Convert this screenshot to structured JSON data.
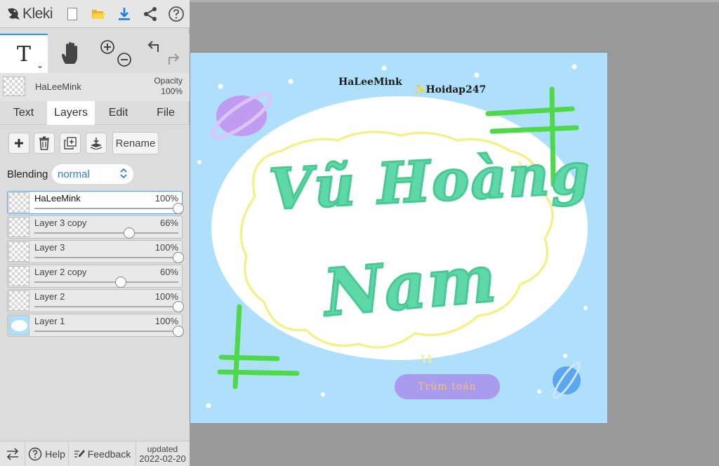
{
  "app": {
    "name": "Kleki"
  },
  "toolbar": {
    "icons": [
      "new-image-icon",
      "open-folder-icon",
      "download-icon",
      "share-icon",
      "help-icon"
    ]
  },
  "tools": {
    "text_tool_glyph": "T",
    "caret": "⌄"
  },
  "active_layer": {
    "name": "HaLeeMink",
    "opacity_label": "Opacity",
    "opacity_value": "100%"
  },
  "tabs": [
    {
      "label": "Text",
      "active": false
    },
    {
      "label": "Layers",
      "active": true
    },
    {
      "label": "Edit",
      "active": false
    },
    {
      "label": "File",
      "active": false
    }
  ],
  "layers_panel": {
    "rename_label": "Rename",
    "blending_label": "Blending",
    "blending_value": "normal",
    "layers": [
      {
        "name": "HaLeeMink",
        "opacity": "100%",
        "opacity_fraction": 1.0,
        "selected": true
      },
      {
        "name": "Layer 3 copy",
        "opacity": "66%",
        "opacity_fraction": 0.66,
        "selected": false
      },
      {
        "name": "Layer 3",
        "opacity": "100%",
        "opacity_fraction": 1.0,
        "selected": false
      },
      {
        "name": "Layer 2 copy",
        "opacity": "60%",
        "opacity_fraction": 0.6,
        "selected": false
      },
      {
        "name": "Layer 2",
        "opacity": "100%",
        "opacity_fraction": 1.0,
        "selected": false
      },
      {
        "name": "Layer 1",
        "opacity": "100%",
        "opacity_fraction": 1.0,
        "selected": false
      }
    ]
  },
  "footer": {
    "help_label": "Help",
    "feedback_label": "Feedback",
    "updated_label": "updated",
    "updated_date": "2022-02-20"
  },
  "canvas": {
    "author_text": "HaLeeMink",
    "site_spark": "✨",
    "site_text": "Hoidap247",
    "name_line1": "Vũ Hoàng",
    "name_line2": "Nam",
    "badge_text": "Trùm toán",
    "colors": {
      "background": "#aee0fb",
      "cloud": "#ffffff",
      "outline": "#f4f18c",
      "lettering": "#5ed8a8",
      "cross": "#4fd84a",
      "planet_left": "#c09bf0",
      "planet_right": "#5aa6f0",
      "badge": "#a99bf0",
      "badge_text": "#f6c06b"
    }
  }
}
